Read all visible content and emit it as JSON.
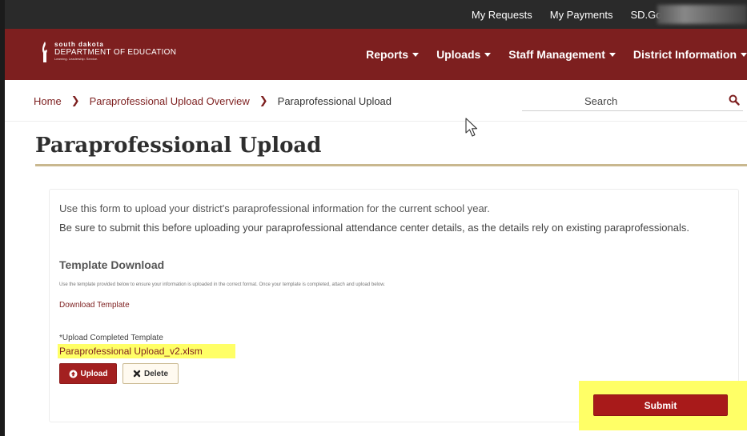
{
  "util_bar": {
    "links": [
      "My Requests",
      "My Payments",
      "SD.Gov"
    ]
  },
  "logo": {
    "line1": "south dakota",
    "line2": "DEPARTMENT OF EDUCATION",
    "line3": "Learning. Leadership. Service."
  },
  "nav": {
    "items": [
      "Reports",
      "Uploads",
      "Staff Management",
      "District Information"
    ]
  },
  "breadcrumb": {
    "home": "Home",
    "overview": "Paraprofessional Upload Overview",
    "current": "Paraprofessional Upload"
  },
  "search": {
    "placeholder": "Search"
  },
  "page": {
    "title": "Paraprofessional Upload",
    "intro1": "Use this form to upload your district's paraprofessional information for the current school year.",
    "intro2": "Be sure to submit this before uploading your paraprofessional attendance center details, as the details rely on existing paraprofessionals."
  },
  "template": {
    "heading": "Template Download",
    "note": "Use the template provided below to ensure your information is uploaded in the correct format. Once your template is completed, attach and upload below.",
    "download_label": "Download Template",
    "upload_label": "*Upload Completed Template",
    "file_name": "Paraprofessional Upload_v2.xlsm"
  },
  "buttons": {
    "upload": "Upload",
    "delete": "Delete",
    "submit": "Submit"
  },
  "colors": {
    "brand": "#7d1f1f",
    "accent_rule": "#c9b88f",
    "highlight": "#ffff66"
  }
}
